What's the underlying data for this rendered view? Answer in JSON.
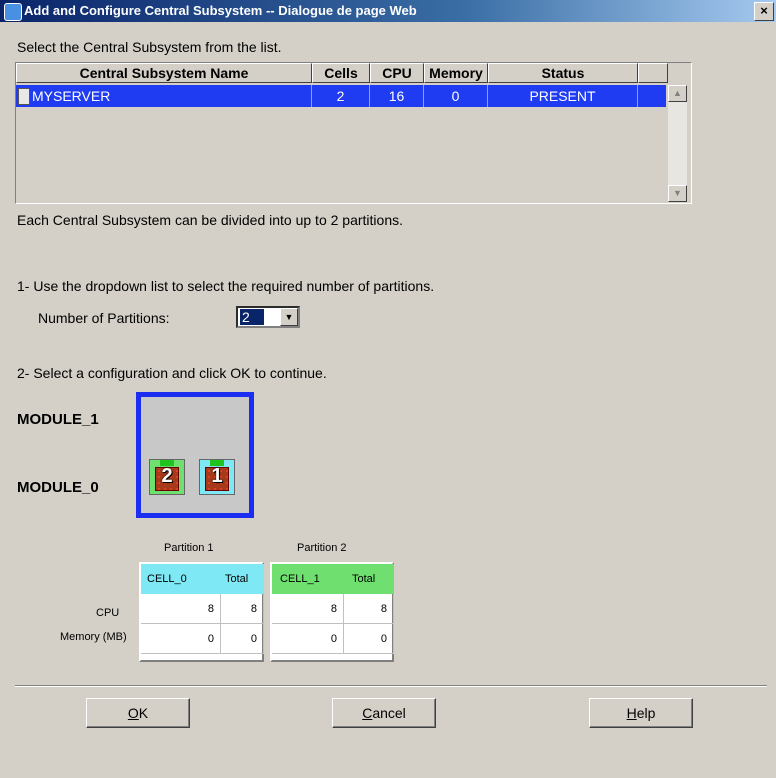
{
  "window": {
    "title": "Add and Configure Central Subsystem -- Dialogue de page Web",
    "close_glyph": "×"
  },
  "intro": "Select the Central Subsystem from the list.",
  "grid": {
    "columns": [
      "Central Subsystem Name",
      "Cells",
      "CPU",
      "Memory",
      "Status"
    ],
    "rows": [
      {
        "name": "MYSERVER",
        "cells": "2",
        "cpu": "16",
        "memory": "0",
        "status": "PRESENT"
      }
    ]
  },
  "divide_note": "Each Central Subsystem can be divided into up to 2 partitions.",
  "step1": "1- Use the dropdown list to select the required number of partitions.",
  "partitions_label": "Number of Partitions:",
  "partitions_value": "2",
  "step2": "2- Select a configuration and click OK to continue.",
  "modules": {
    "module1": "MODULE_1",
    "module0": "MODULE_0",
    "chips": [
      {
        "number": "2",
        "color": "#6fe06f"
      },
      {
        "number": "1",
        "color": "#7fe8f5"
      }
    ]
  },
  "partition_tables": [
    {
      "title": "Partition 1",
      "cell": "CELL_0",
      "total": "Total",
      "color": "#7fe8f5",
      "cpu": [
        "8",
        "8"
      ],
      "memory": [
        "0",
        "0"
      ]
    },
    {
      "title": "Partition 2",
      "cell": "CELL_1",
      "total": "Total",
      "color": "#6fe06f",
      "cpu": [
        "8",
        "8"
      ],
      "memory": [
        "0",
        "0"
      ]
    }
  ],
  "row_labels": {
    "cpu": "CPU",
    "memory": "Memory (MB)"
  },
  "buttons": {
    "ok_key": "O",
    "ok_rest": "K",
    "cancel_key": "C",
    "cancel_rest": "ancel",
    "help_key": "H",
    "help_rest": "elp"
  }
}
